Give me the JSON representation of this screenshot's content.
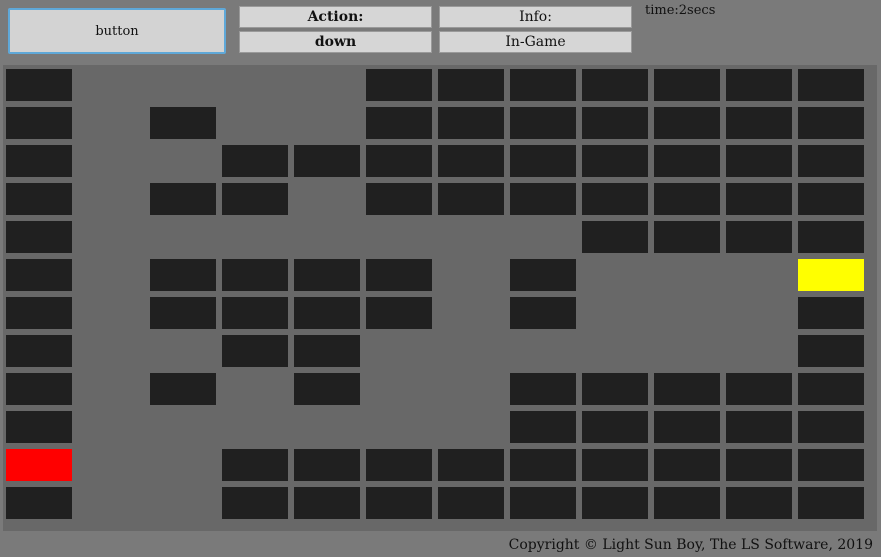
{
  "button": {
    "label": "button"
  },
  "action": {
    "title": "Action:",
    "value": "down"
  },
  "info": {
    "title": "Info:",
    "value": "In-Game"
  },
  "timer": {
    "text": "time:2secs"
  },
  "copyright": {
    "text": "Copyright © Light Sun Boy, The LS Software, 2019"
  },
  "colors": {
    "wall": "#202020",
    "floor": "#686868",
    "player": "#ff0000",
    "goal": "#ffff00"
  },
  "maze": {
    "rows": 12,
    "cols": 12,
    "legend": {
      "#": "wall",
      ".": "open",
      "P": "player",
      "G": "goal"
    },
    "grid": [
      "#....#######",
      "#.#..#######",
      "#..#########",
      "#.##.#######",
      "#.......####",
      "#.####.#...G",
      "#.####.#...#",
      "#..##......#",
      "#.#.#..#####",
      "#......#####",
      "P..#########",
      "#..#########"
    ]
  }
}
